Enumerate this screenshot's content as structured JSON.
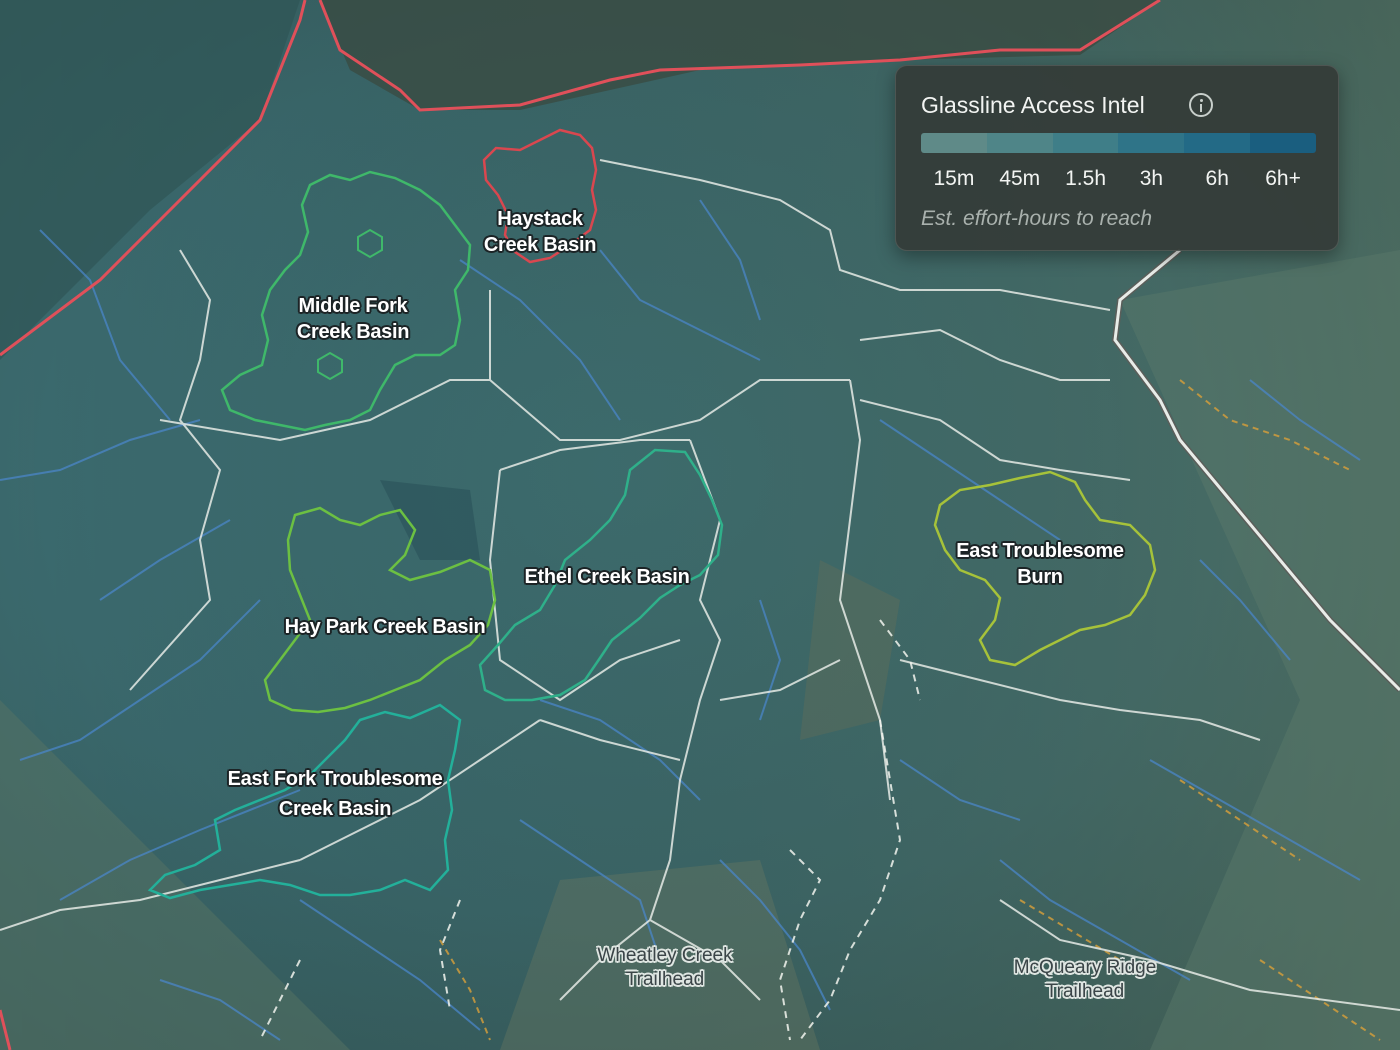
{
  "legend": {
    "title": "Glassline Access Intel",
    "note": "Est. effort-hours to reach",
    "scale": [
      {
        "label": "15m",
        "color": "#5f8a88"
      },
      {
        "label": "45m",
        "color": "#4f8588"
      },
      {
        "label": "1.5h",
        "color": "#3f7e88"
      },
      {
        "label": "3h",
        "color": "#2f7488"
      },
      {
        "label": "6h",
        "color": "#236a86"
      },
      {
        "label": "6h+",
        "color": "#1a5e7f"
      }
    ]
  },
  "areas": {
    "haystack": {
      "line1": "Haystack",
      "line2": "Creek Basin",
      "color": "#d9474f"
    },
    "middle_fork": {
      "line1": "Middle Fork",
      "line2": "Creek Basin",
      "color": "#3fb86a"
    },
    "ethel": {
      "line1": "Ethel Creek Basin",
      "color": "#2fb08a"
    },
    "hay_park": {
      "line1": "Hay Park Creek Basin",
      "color": "#6cc042"
    },
    "east_fork": {
      "line1": "East Fork Troublesome",
      "line2": "Creek Basin",
      "color": "#23b09a"
    },
    "east_troublesome_burn": {
      "line1": "East Troublesome",
      "line2": "Burn",
      "color": "#a6c23a"
    }
  },
  "trailheads": {
    "wheatley": {
      "line1": "Wheatley Creek",
      "line2": "Trailhead"
    },
    "mcqueary": {
      "line1": "McQueary Ridge",
      "line2": "Trailhead"
    }
  },
  "map_colors": {
    "boundary": "#e0505a",
    "roads": "#e6ebe6",
    "streams": "#4a86c8",
    "trails": "#d9a03a"
  }
}
